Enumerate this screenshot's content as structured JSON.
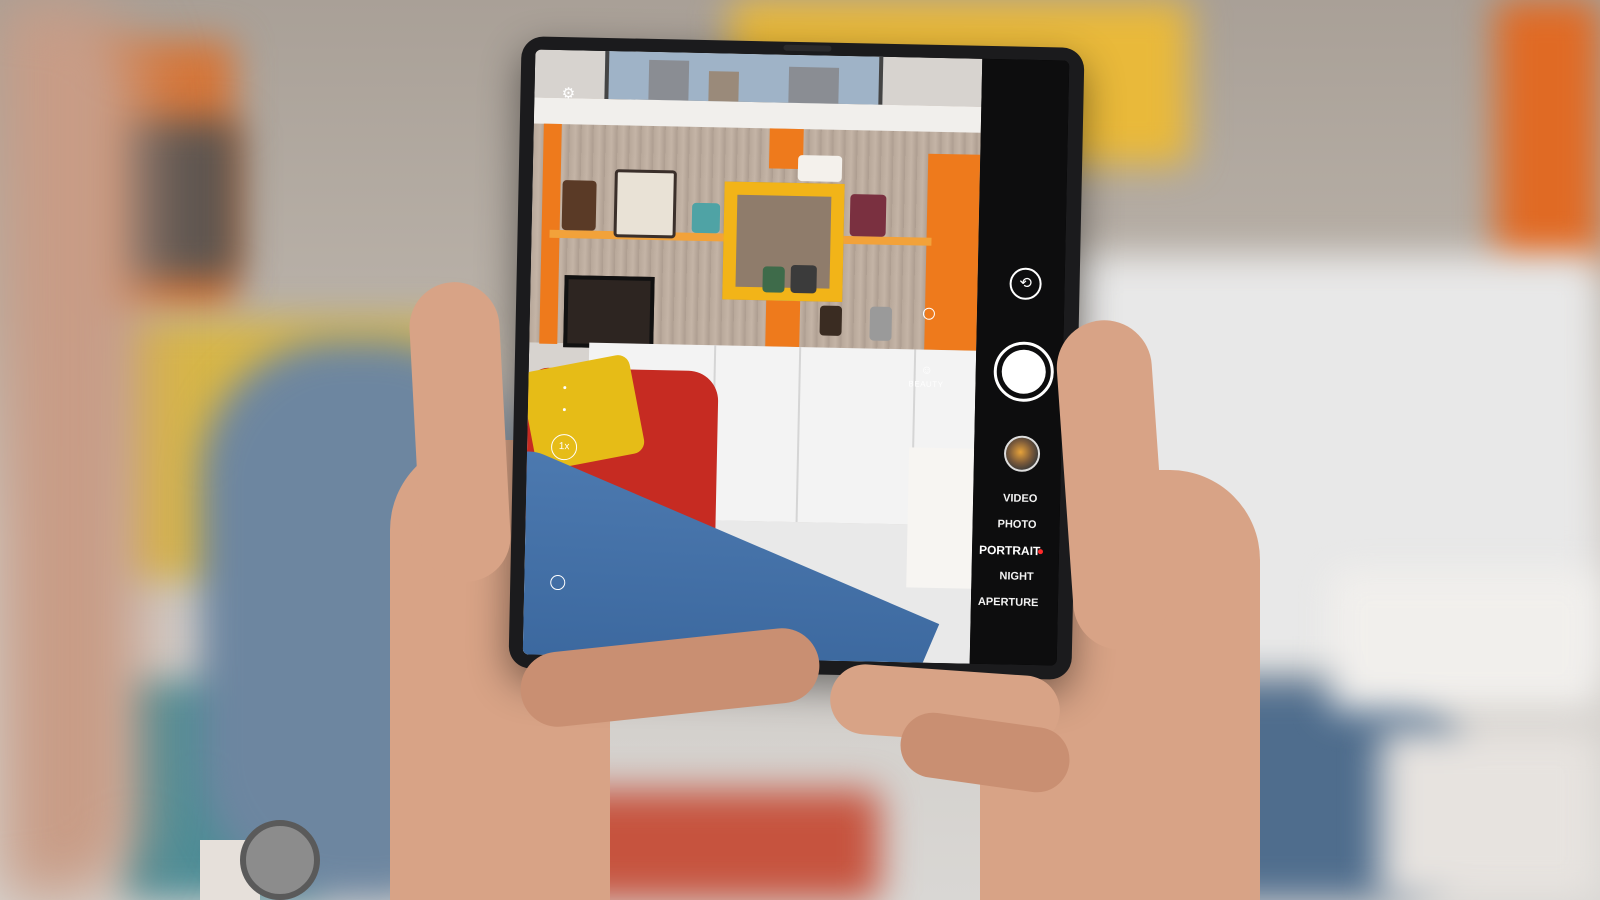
{
  "camera_app": {
    "modes": [
      {
        "label": "VIDEO",
        "active": false
      },
      {
        "label": "PHOTO",
        "active": false
      },
      {
        "label": "PORTRAIT",
        "active": true
      },
      {
        "label": "NIGHT",
        "active": false
      },
      {
        "label": "APERTURE",
        "active": false
      }
    ],
    "zoom_label": "1x",
    "beauty_label": "BEAUTY",
    "active_mode_indicator_color": "#ff2a2a",
    "icons": [
      "settings-icon",
      "zoom-button",
      "timer-icon",
      "beauty-icon",
      "aperture-icon",
      "camera-switch-icon",
      "shutter-button",
      "gallery-thumbnail"
    ]
  },
  "scene": {
    "subject": "hands holding foldable phone in camera portrait mode",
    "accent_colors": {
      "orange": "#ee7a1c",
      "yellow": "#f2b418",
      "red": "#c62b22",
      "denim": "#3f6ba2"
    }
  }
}
